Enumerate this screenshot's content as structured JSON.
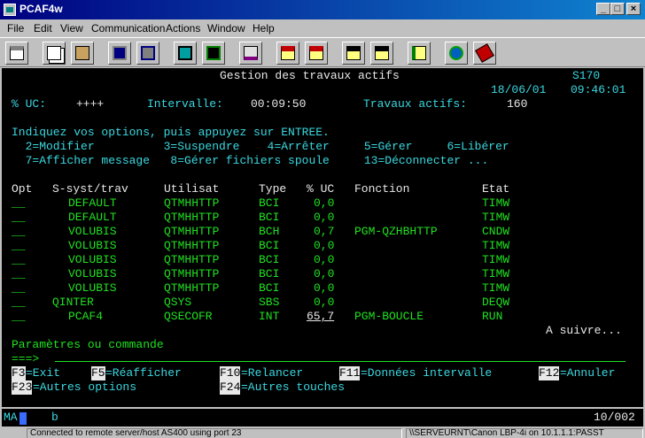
{
  "window": {
    "title": "PCAF4w"
  },
  "menu": [
    "File",
    "Edit",
    "View",
    "Communication",
    "Actions",
    "Window",
    "Help"
  ],
  "toolbar_icons": [
    "print-icon",
    "copy-icon",
    "paste-icon",
    "send-icon",
    "receive-icon",
    "display-icon",
    "macro-icon",
    "edit-icon",
    "record-icon",
    "stop-icon",
    "play-icon",
    "pause-icon",
    "clipboard-icon",
    "globe-icon",
    "book-icon"
  ],
  "screen": {
    "title": "Gestion des travaux actifs",
    "system": "S170",
    "date": "18/06/01",
    "time": "09:46:01",
    "cpu_label": "% UC:",
    "cpu_value": "++++",
    "interval_label": "Intervalle:",
    "interval_value": "00:09:50",
    "jobs_label": "Travaux actifs:",
    "jobs_value": "160",
    "instructions": "Indiquez vos options, puis appuyez sur ENTREE.",
    "options_line1": "  2=Modifier          3=Suspendre    4=Arrêter     5=Gérer     6=Libérer",
    "options_line2": "  7=Afficher message   8=Gérer fichiers spoule     13=Déconnecter ...",
    "headers": {
      "opt": "Opt",
      "subsys": "S-syst/trav",
      "user": "Utilisat",
      "type": "Type",
      "cpu": "% UC",
      "function": "Fonction",
      "status": "Etat"
    },
    "rows": [
      {
        "opt": "__",
        "subsys": "DEFAULT",
        "user": "QTMHHTTP",
        "type": "BCI",
        "cpu": "0,0",
        "function": "",
        "status": "TIMW"
      },
      {
        "opt": "__",
        "subsys": "DEFAULT",
        "user": "QTMHHTTP",
        "type": "BCI",
        "cpu": "0,0",
        "function": "",
        "status": "TIMW"
      },
      {
        "opt": "__",
        "subsys": "VOLUBIS",
        "user": "QTMHHTTP",
        "type": "BCH",
        "cpu": "0,7",
        "function": "PGM-QZHBHTTP",
        "status": "CNDW"
      },
      {
        "opt": "__",
        "subsys": "VOLUBIS",
        "user": "QTMHHTTP",
        "type": "BCI",
        "cpu": "0,0",
        "function": "",
        "status": "TIMW"
      },
      {
        "opt": "__",
        "subsys": "VOLUBIS",
        "user": "QTMHHTTP",
        "type": "BCI",
        "cpu": "0,0",
        "function": "",
        "status": "TIMW"
      },
      {
        "opt": "__",
        "subsys": "VOLUBIS",
        "user": "QTMHHTTP",
        "type": "BCI",
        "cpu": "0,0",
        "function": "",
        "status": "TIMW"
      },
      {
        "opt": "__",
        "subsys": "VOLUBIS",
        "user": "QTMHHTTP",
        "type": "BCI",
        "cpu": "0,0",
        "function": "",
        "status": "TIMW"
      },
      {
        "opt": "__",
        "subsys": "QINTER",
        "user": "QSYS",
        "type": "SBS",
        "cpu": "0,0",
        "function": "",
        "status": "DEQW"
      },
      {
        "opt": "__",
        "subsys": "PCAF4",
        "user": "QSECOFR",
        "type": "INT",
        "cpu": "65,7",
        "function": "PGM-BOUCLE",
        "status": "RUN"
      }
    ],
    "more": "A suivre...",
    "params_label": "Paramètres ou commande",
    "prompt": "===>",
    "fkeys_row1": [
      {
        "key": "F3",
        "label": "=Exit"
      },
      {
        "key": "F5",
        "label": "=Réafficher"
      },
      {
        "key": "F10",
        "label": "=Relancer"
      },
      {
        "key": "F11",
        "label": "=Données intervalle"
      },
      {
        "key": "F12",
        "label": "=Annuler"
      }
    ],
    "fkeys_row2": [
      {
        "key": "F23",
        "label": "=Autres options"
      },
      {
        "key": "F24",
        "label": "=Autres touches"
      }
    ]
  },
  "oia": {
    "indicator": "MA",
    "flag": "b",
    "cursor": "10/002"
  },
  "status": {
    "connection": "Connected to remote server/host AS400 using port 23",
    "printer": "\\\\SERVEURNT\\Canon LBP-4i on 10.1.1.1:PASST"
  },
  "colors": {
    "terminal_bg": "#000000",
    "green": "#20e020",
    "cyan": "#3ad8e0",
    "white": "#e8e8e8",
    "titlebar": "#000080"
  }
}
